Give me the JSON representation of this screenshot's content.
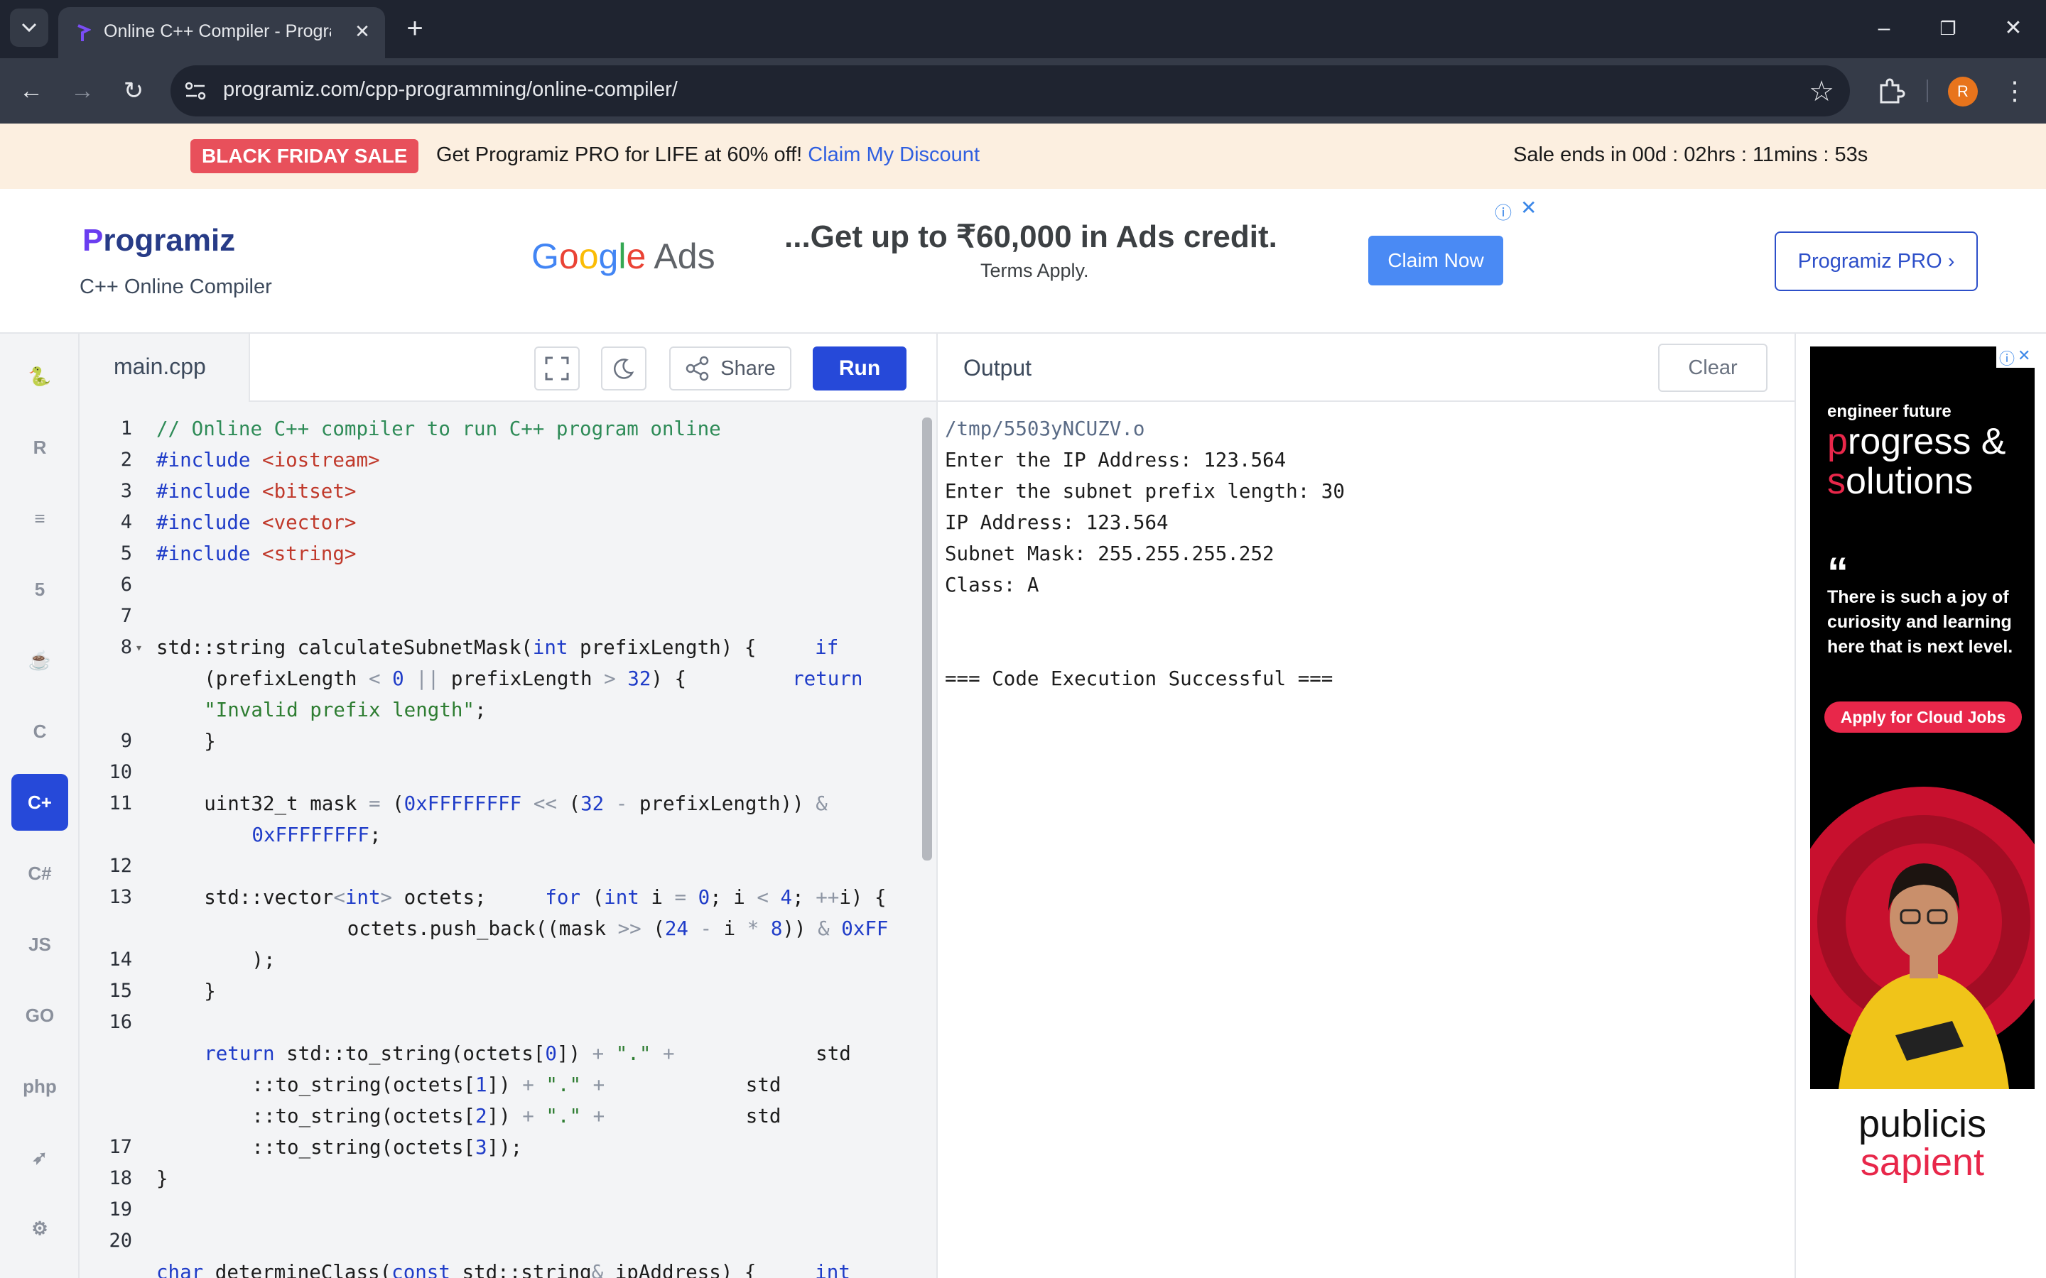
{
  "browser": {
    "tab_title": "Online C++ Compiler - Program",
    "url": "programiz.com/cpp-programming/online-compiler/",
    "profile_initial": "R"
  },
  "banner": {
    "badge": "BLACK FRIDAY SALE",
    "text": "Get Programiz PRO for LIFE at 60% off!",
    "link": "Claim My Discount",
    "timer": "Sale ends in 00d : 02hrs : 11mins : 53s"
  },
  "header": {
    "logo_initial": "P",
    "logo_rest": "rogramiz",
    "subtitle": "C++ Online Compiler",
    "pro_button": "Programiz PRO ›"
  },
  "top_ad": {
    "brand_G": "G",
    "brand_o1": "o",
    "brand_o2": "o",
    "brand_g": "g",
    "brand_l": "l",
    "brand_e": "e",
    "brand_suffix": "Ads",
    "headline": "...Get up to ₹60,000 in Ads credit.",
    "terms": "Terms Apply.",
    "cta": "Claim Now"
  },
  "sidebar": {
    "languages": [
      {
        "name": "python"
      },
      {
        "name": "r"
      },
      {
        "name": "sql"
      },
      {
        "name": "html"
      },
      {
        "name": "java"
      },
      {
        "name": "c"
      },
      {
        "name": "cpp",
        "active": true
      },
      {
        "name": "csharp"
      },
      {
        "name": "javascript",
        "label": "JS"
      },
      {
        "name": "go",
        "label": "GO"
      },
      {
        "name": "php",
        "label": "php"
      },
      {
        "name": "swift"
      },
      {
        "name": "rust"
      }
    ]
  },
  "editor": {
    "filename": "main.cpp",
    "share_label": "Share",
    "run_label": "Run",
    "gutter": [
      {
        "n": "1",
        "row": 0
      },
      {
        "n": "2",
        "row": 1
      },
      {
        "n": "3",
        "row": 2
      },
      {
        "n": "4",
        "row": 3
      },
      {
        "n": "5",
        "row": 4
      },
      {
        "n": "6",
        "row": 5
      },
      {
        "n": "7",
        "row": 6
      },
      {
        "n": "8",
        "row": 7,
        "fold": true
      },
      {
        "n": "9",
        "row": 10
      },
      {
        "n": "10",
        "row": 11
      },
      {
        "n": "11",
        "row": 12
      },
      {
        "n": "12",
        "row": 14
      },
      {
        "n": "13",
        "row": 15
      },
      {
        "n": "14",
        "row": 17
      },
      {
        "n": "15",
        "row": 18
      },
      {
        "n": "16",
        "row": 19
      },
      {
        "n": "17",
        "row": 23
      },
      {
        "n": "18",
        "row": 24
      },
      {
        "n": "19",
        "row": 25
      },
      {
        "n": "20",
        "row": 26
      }
    ],
    "code": [
      {
        "row": 0,
        "indent": 0,
        "tokens": [
          [
            "cm",
            "// Online C++ compiler to run C++ program online"
          ]
        ]
      },
      {
        "row": 1,
        "indent": 0,
        "tokens": [
          [
            "kw",
            "#include "
          ],
          [
            "ih",
            "<iostream>"
          ]
        ]
      },
      {
        "row": 2,
        "indent": 0,
        "tokens": [
          [
            "kw",
            "#include "
          ],
          [
            "ih",
            "<bitset>"
          ]
        ]
      },
      {
        "row": 3,
        "indent": 0,
        "tokens": [
          [
            "kw",
            "#include "
          ],
          [
            "ih",
            "<vector>"
          ]
        ]
      },
      {
        "row": 4,
        "indent": 0,
        "tokens": [
          [
            "kw",
            "#include "
          ],
          [
            "ih",
            "<string>"
          ]
        ]
      },
      {
        "row": 7,
        "indent": 0,
        "tokens": [
          [
            "",
            "std::string calculateSubnetMask("
          ],
          [
            "kw",
            "int"
          ],
          [
            "",
            " prefixLength) {     "
          ],
          [
            "kw",
            "if"
          ]
        ]
      },
      {
        "row": 8,
        "indent": 4,
        "tokens": [
          [
            "",
            "(prefixLength "
          ],
          [
            "op",
            "<"
          ],
          [
            "",
            " "
          ],
          [
            "nm",
            "0"
          ],
          [
            "",
            " "
          ],
          [
            "op",
            "||"
          ],
          [
            "",
            " prefixLength "
          ],
          [
            "op",
            ">"
          ],
          [
            "",
            " "
          ],
          [
            "nm",
            "32"
          ],
          [
            "",
            ") {         "
          ],
          [
            "kw",
            "return"
          ]
        ]
      },
      {
        "row": 9,
        "indent": 4,
        "tokens": [
          [
            "st",
            "\"Invalid prefix length\""
          ],
          [
            "",
            ";"
          ]
        ]
      },
      {
        "row": 10,
        "indent": 4,
        "tokens": [
          [
            "",
            "}"
          ]
        ]
      },
      {
        "row": 12,
        "indent": 4,
        "tokens": [
          [
            "",
            "uint32_t mask "
          ],
          [
            "op",
            "="
          ],
          [
            "",
            " ("
          ],
          [
            "nm",
            "0xFFFFFFFF"
          ],
          [
            "",
            " "
          ],
          [
            "op",
            "<<"
          ],
          [
            "",
            " ("
          ],
          [
            "nm",
            "32"
          ],
          [
            "",
            " "
          ],
          [
            "op",
            "-"
          ],
          [
            "",
            " prefixLength)) "
          ],
          [
            "op",
            "&"
          ]
        ]
      },
      {
        "row": 13,
        "indent": 8,
        "tokens": [
          [
            "nm",
            "0xFFFFFFFF"
          ],
          [
            "",
            ";"
          ]
        ]
      },
      {
        "row": 15,
        "indent": 4,
        "tokens": [
          [
            "",
            "std::vector"
          ],
          [
            "op",
            "<"
          ],
          [
            "kw",
            "int"
          ],
          [
            "op",
            ">"
          ],
          [
            "",
            " octets;     "
          ],
          [
            "kw",
            "for"
          ],
          [
            "",
            " ("
          ],
          [
            "kw",
            "int"
          ],
          [
            "",
            " i "
          ],
          [
            "op",
            "="
          ],
          [
            "",
            " "
          ],
          [
            "nm",
            "0"
          ],
          [
            "",
            "; i "
          ],
          [
            "op",
            "<"
          ],
          [
            "",
            " "
          ],
          [
            "nm",
            "4"
          ],
          [
            "",
            "; "
          ],
          [
            "op",
            "++"
          ],
          [
            "",
            "i) {"
          ]
        ]
      },
      {
        "row": 16,
        "indent": 16,
        "tokens": [
          [
            "",
            "octets.push_back((mask "
          ],
          [
            "op",
            ">>"
          ],
          [
            "",
            " ("
          ],
          [
            "nm",
            "24"
          ],
          [
            "",
            " "
          ],
          [
            "op",
            "-"
          ],
          [
            "",
            " i "
          ],
          [
            "op",
            "*"
          ],
          [
            "",
            " "
          ],
          [
            "nm",
            "8"
          ],
          [
            "",
            ")) "
          ],
          [
            "op",
            "&"
          ],
          [
            "",
            " "
          ],
          [
            "nm",
            "0xFF"
          ]
        ]
      },
      {
        "row": 17,
        "indent": 8,
        "tokens": [
          [
            "",
            ");"
          ]
        ]
      },
      {
        "row": 18,
        "indent": 4,
        "tokens": [
          [
            "",
            "}"
          ]
        ]
      },
      {
        "row": 20,
        "indent": 4,
        "tokens": [
          [
            "kw",
            "return"
          ],
          [
            "",
            " std::to_string(octets["
          ],
          [
            "nm",
            "0"
          ],
          [
            "",
            "]) "
          ],
          [
            "op",
            "+"
          ],
          [
            "",
            " "
          ],
          [
            "st",
            "\".\""
          ],
          [
            "",
            " "
          ],
          [
            "op",
            "+"
          ],
          [
            "",
            "            std"
          ]
        ]
      },
      {
        "row": 21,
        "indent": 8,
        "tokens": [
          [
            "",
            "::to_string(octets["
          ],
          [
            "nm",
            "1"
          ],
          [
            "",
            "]) "
          ],
          [
            "op",
            "+"
          ],
          [
            "",
            " "
          ],
          [
            "st",
            "\".\""
          ],
          [
            "",
            " "
          ],
          [
            "op",
            "+"
          ],
          [
            "",
            "            std"
          ]
        ]
      },
      {
        "row": 22,
        "indent": 8,
        "tokens": [
          [
            "",
            "::to_string(octets["
          ],
          [
            "nm",
            "2"
          ],
          [
            "",
            "]) "
          ],
          [
            "op",
            "+"
          ],
          [
            "",
            " "
          ],
          [
            "st",
            "\".\""
          ],
          [
            "",
            " "
          ],
          [
            "op",
            "+"
          ],
          [
            "",
            "            std"
          ]
        ]
      },
      {
        "row": 23,
        "indent": 8,
        "tokens": [
          [
            "",
            "::to_string(octets["
          ],
          [
            "nm",
            "3"
          ],
          [
            "",
            "]);"
          ]
        ]
      },
      {
        "row": 24,
        "indent": 0,
        "tokens": [
          [
            "",
            "}"
          ]
        ]
      },
      {
        "row": 27,
        "indent": 0,
        "tokens": [
          [
            "kw",
            "char"
          ],
          [
            "",
            " determineClass("
          ],
          [
            "kw",
            "const"
          ],
          [
            "",
            " std::string"
          ],
          [
            "op",
            "&"
          ],
          [
            "",
            " ipAddress) {     "
          ],
          [
            "kw",
            "int"
          ]
        ]
      }
    ]
  },
  "output": {
    "title": "Output",
    "clear_label": "Clear",
    "lines": [
      {
        "row": 0,
        "text": "/tmp/5503yNCUZV.o",
        "kind": "path"
      },
      {
        "row": 1,
        "text": "Enter the IP Address: 123.564"
      },
      {
        "row": 2,
        "text": "Enter the subnet prefix length: 30"
      },
      {
        "row": 3,
        "text": "IP Address: 123.564"
      },
      {
        "row": 4,
        "text": "Subnet Mask: 255.255.255.252"
      },
      {
        "row": 5,
        "text": "Class: A"
      },
      {
        "row": 8,
        "text": "=== Code Execution Successful ==="
      }
    ]
  },
  "side_ad": {
    "eyebrow": "engineer future",
    "title_1a": "p",
    "title_1b": "rogress &",
    "title_2a": "s",
    "title_2b": "olutions",
    "quote_mark": "“",
    "quote": "There is such a joy of curiosity and learning here that is next level.",
    "cta": "Apply for Cloud Jobs",
    "brand_1": "publicis",
    "brand_2": "sapient"
  },
  "colors": {
    "accent": "#2649d9",
    "sale_red": "#e8505b",
    "ad_red": "#e8274a"
  }
}
